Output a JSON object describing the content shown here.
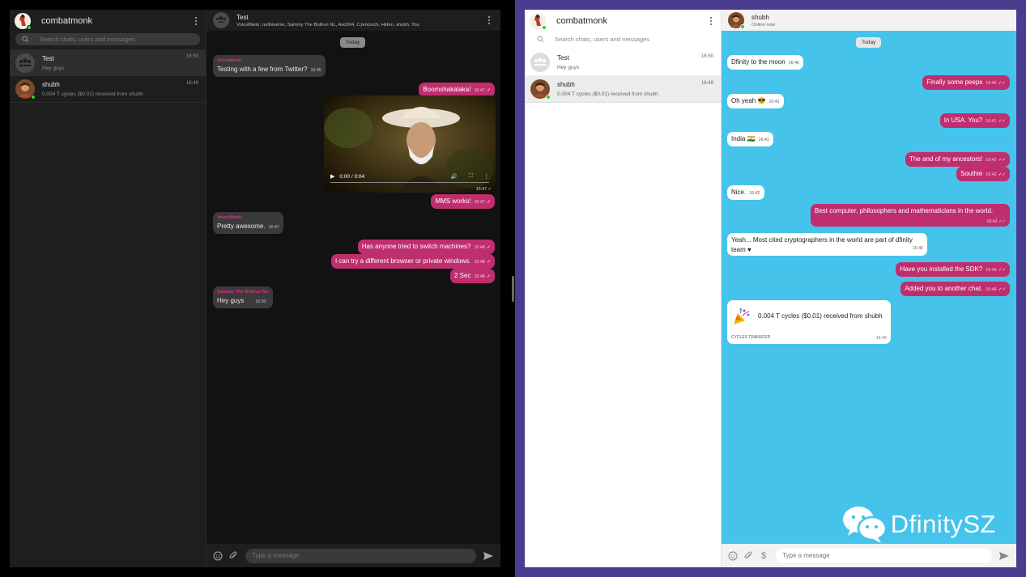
{
  "colors": {
    "accent": "#bf2e6e",
    "online": "#2ecc40",
    "dark_sidebar": "#1e1e1e",
    "dark_chat": "#121212",
    "light_chat": "#45c3ea",
    "frame_purple": "#4a3c8f"
  },
  "dark": {
    "sidebar": {
      "title": "combatmonk",
      "search_placeholder": "Search chats, users and messages",
      "chats": [
        {
          "name": "Test",
          "preview": "Hey guys",
          "time": "16:50",
          "avatar_icon": "group-icon"
        },
        {
          "name": "shubh",
          "preview": "0.004 T cycles ($0.01) received from shubh",
          "time": "16:49",
          "avatar_icon": "user-avatar"
        }
      ]
    },
    "chat": {
      "title": "Test",
      "members": "VoiceMarkr, nullniverse, Sammy The Bullrun NL, Aso504, CJentzsch, Hiden, shubh, You",
      "day": "Today",
      "messages": [
        {
          "sender": "VoiceMarkr",
          "text": "Testing with a few from Twitter?",
          "time": "16:45",
          "out": false
        },
        {
          "text": "Boomshakalaka!",
          "time": "16:47",
          "out": true
        },
        {
          "text": "MMS works!",
          "time": "16:47",
          "out": true
        },
        {
          "sender": "VoiceMarkr",
          "text": "Pretty awesome.",
          "time": "16:47",
          "out": false
        },
        {
          "text": "Has anyone tried to switch machines?",
          "time": "16:48",
          "out": true
        },
        {
          "text": "I can try a different browser or private windows.",
          "time": "16:48",
          "out": true
        },
        {
          "text": "2 Sec",
          "time": "16:48",
          "out": true
        },
        {
          "sender": "Sammy The Bullrun NL",
          "text": "Hey guys",
          "time": "16:50",
          "out": false
        }
      ],
      "video": {
        "time_display": "0:00 / 0:04",
        "timestamp": "16:47"
      },
      "composer_placeholder": "Type a message"
    }
  },
  "light": {
    "sidebar": {
      "title": "combatmonk",
      "search_placeholder": "Search chats, users and messages",
      "chats": [
        {
          "name": "Test",
          "preview": "Hey guys",
          "time": "16:50",
          "avatar_icon": "group-icon"
        },
        {
          "name": "shubh",
          "preview": "0.004 T cycles ($0.01) received from shubh",
          "time": "16:49",
          "avatar_icon": "user-avatar"
        }
      ]
    },
    "chat": {
      "title": "shubh",
      "status": "Online now",
      "day": "Today",
      "messages": [
        {
          "text": "Dfinity to the moon",
          "time": "16:40",
          "out": false
        },
        {
          "text": "Finally some peeps",
          "time": "16:40",
          "out": true
        },
        {
          "text": "Oh yeah 😎",
          "time": "16:41",
          "out": false
        },
        {
          "text": "In USA. You?",
          "time": "16:41",
          "out": true
        },
        {
          "text": "India 🇮🇳",
          "time": "16:41",
          "out": false
        },
        {
          "text": "The and of my ancestors!",
          "time": "16:42",
          "out": true
        },
        {
          "text": "Southie",
          "time": "16:42",
          "out": true
        },
        {
          "text": "Nice.",
          "time": "16:42",
          "out": false
        },
        {
          "text": "Best computer, philosophers and mathematicians in the world.",
          "time": "16:42",
          "out": true
        },
        {
          "text": "Yeah... Most cited cryptographers in the world are part of dfinity team ♥",
          "time": "16:46",
          "out": false
        },
        {
          "text": "Have you installed the SDK?",
          "time": "16:48",
          "out": true
        },
        {
          "text": "Added you to another chat.",
          "time": "16:48",
          "out": true
        }
      ],
      "transfer": {
        "text": "0.004 T cycles ($0.01) received from shubh",
        "label": "CYCLES TRANSFER",
        "time": "16:49"
      },
      "composer_placeholder": "Type a message"
    },
    "watermark": "DfinitySZ"
  }
}
